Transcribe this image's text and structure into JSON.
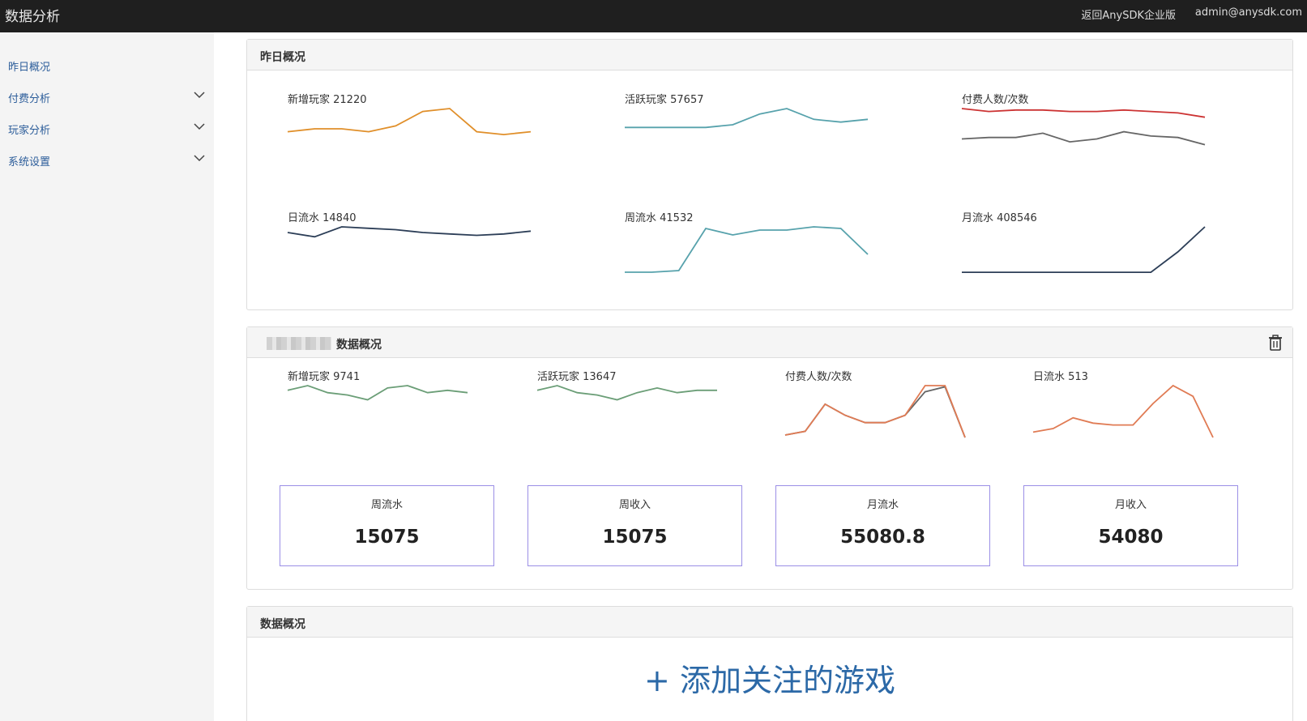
{
  "app": {
    "title": "数据分析",
    "back_link": "返回AnySDK企业版",
    "user": "admin@anysdk.com"
  },
  "sidebar": {
    "items": [
      {
        "label": "昨日概况",
        "expandable": false
      },
      {
        "label": "付费分析",
        "expandable": true
      },
      {
        "label": "玩家分析",
        "expandable": true
      },
      {
        "label": "系统设置",
        "expandable": true
      }
    ]
  },
  "panel1": {
    "title": "昨日概况",
    "sparks": [
      {
        "label": "新增玩家 21220",
        "color": "#e08f2a",
        "series": [
          [
            6,
            7,
            7,
            6,
            8,
            13,
            14,
            6,
            5,
            6
          ]
        ]
      },
      {
        "label": "活跃玩家 57657",
        "color": "#57a2ac",
        "series": [
          [
            8,
            8,
            8,
            8,
            9,
            13,
            15,
            11,
            10,
            11
          ]
        ]
      },
      {
        "label": "付费人数/次数",
        "colors": [
          "#666666",
          "#cc3333"
        ],
        "series": [
          [
            7,
            8,
            8,
            11,
            5,
            7,
            12,
            9,
            8,
            3
          ],
          [
            28,
            26,
            27,
            27,
            26,
            26,
            27,
            26,
            25,
            22
          ]
        ]
      },
      {
        "label": "日流水 14840",
        "color": "#2c3e57",
        "series": [
          [
            29,
            26,
            33,
            32,
            31,
            29,
            28,
            27,
            28,
            30
          ]
        ]
      },
      {
        "label": "周流水 41532",
        "color": "#57a2ac",
        "series": [
          [
            1,
            1,
            2,
            28,
            24,
            27,
            27,
            29,
            28,
            12
          ]
        ]
      },
      {
        "label": "月流水 408546",
        "color": "#2c3e57",
        "series": [
          [
            1,
            1,
            1,
            1,
            1,
            1,
            1,
            1,
            14,
            30
          ]
        ]
      }
    ]
  },
  "panel2": {
    "title": "数据概况",
    "sparks": [
      {
        "label": "新增玩家 9741",
        "color": "#6b9e77",
        "series": [
          [
            20,
            22,
            19,
            18,
            16,
            21,
            22,
            19,
            20,
            19
          ]
        ]
      },
      {
        "label": "活跃玩家 13647",
        "color": "#6b9e77",
        "series": [
          [
            20,
            22,
            19,
            18,
            16,
            19,
            21,
            19,
            20,
            20
          ]
        ]
      },
      {
        "label": "付费人数/次数",
        "colors": [
          "#666666",
          "#e07b54"
        ],
        "series": [
          [
            2,
            5,
            27,
            18,
            12,
            12,
            18,
            37,
            41,
            0
          ],
          [
            2,
            5,
            27,
            18,
            12,
            12,
            18,
            42,
            42,
            0
          ]
        ]
      },
      {
        "label": "日流水 513",
        "color": "#e07b54",
        "series": [
          [
            3,
            5,
            11,
            8,
            7,
            7,
            19,
            29,
            23,
            0
          ]
        ]
      }
    ],
    "stats": [
      {
        "label": "周流水",
        "value": "15075"
      },
      {
        "label": "周收入",
        "value": "15075"
      },
      {
        "label": "月流水",
        "value": "55080.8"
      },
      {
        "label": "月收入",
        "value": "54080"
      }
    ]
  },
  "panel3": {
    "title": "数据概况",
    "add_label": "+ 添加关注的游戏"
  }
}
